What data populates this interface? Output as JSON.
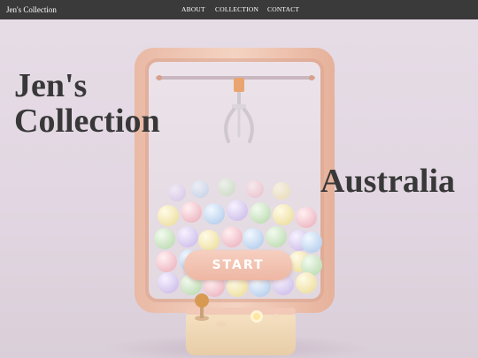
{
  "nav": {
    "brand": "Jen's Collection",
    "links": [
      {
        "label": "ABOUT"
      },
      {
        "label": "COLLECTION"
      },
      {
        "label": "CONTACT"
      }
    ]
  },
  "hero": {
    "title_line1": "Jen's",
    "title_line2": "Collection",
    "subtitle": "Australia",
    "cta_label": "START"
  },
  "colors": {
    "navbar": "#3a3a3a",
    "background": "#e1d6e1",
    "title_text": "#383838",
    "machine_frame": "#f1c9b6",
    "start_button": "#eeb7a4"
  }
}
